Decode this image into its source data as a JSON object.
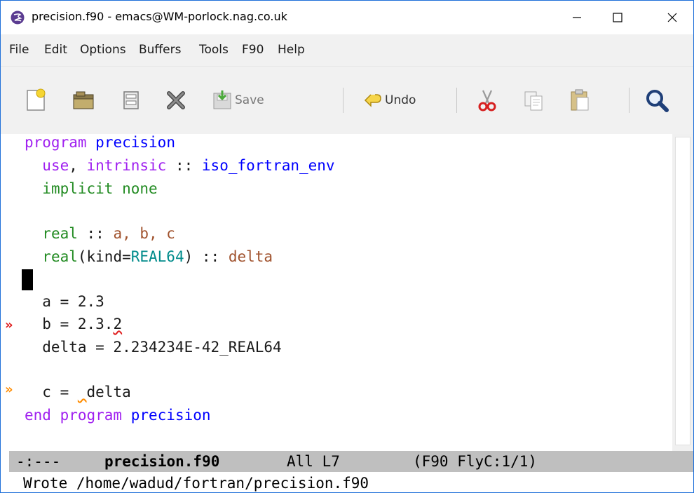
{
  "window": {
    "title": "precision.f90 - emacs@WM-porlock.nag.co.uk",
    "minimize_glyph": "—",
    "maximize_glyph": "☐",
    "close_glyph": "✕"
  },
  "menubar": {
    "items": [
      "File",
      "Edit",
      "Options",
      "Buffers",
      "Tools",
      "F90",
      "Help"
    ]
  },
  "toolbar": {
    "save_label": "Save",
    "undo_label": "Undo",
    "icons": [
      "new-file-icon",
      "open-folder-icon",
      "dired-icon",
      "close-buffer-icon",
      "save-icon",
      "undo-icon",
      "cut-icon",
      "copy-icon",
      "paste-icon",
      "search-icon"
    ]
  },
  "editor": {
    "lines": [
      [
        "program",
        " ",
        "precision"
      ],
      [
        "  ",
        "use",
        ", ",
        "intrinsic",
        " :: ",
        "iso_fortran_env"
      ],
      [
        "  ",
        "implicit none"
      ],
      [
        "  ",
        "real",
        " :: ",
        "a, b, c"
      ],
      [
        "  ",
        "real",
        "(kind=",
        "REAL64",
        ") :: ",
        "delta"
      ],
      [
        "  a = 2.3"
      ],
      [
        "  b = 2.3.",
        "2"
      ],
      [
        "  delta = 2.234234E-42_REAL64"
      ],
      [
        "  c = ",
        " ",
        "delta"
      ],
      [
        "end program",
        " ",
        "precision"
      ]
    ],
    "error_marker": "»",
    "warning_marker": "»",
    "colors": {
      "keyword": "#a020f0",
      "function_name": "#0000ff",
      "type": "#228b22",
      "variable": "#a0522d",
      "constant": "#008b8b",
      "error": "#e02020",
      "warning": "#ff8c00"
    }
  },
  "modeline": {
    "status": "-:---",
    "buffer_name": "precision.f90",
    "position": "All L7",
    "modes": "(F90 FlyC:1/1)"
  },
  "echo_area": {
    "message": "Wrote /home/wadud/fortran/precision.f90"
  }
}
